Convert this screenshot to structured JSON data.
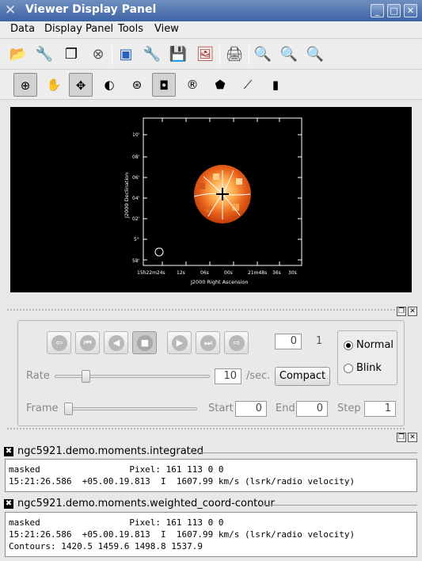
{
  "window": {
    "title": "Viewer Display Panel"
  },
  "menubar": {
    "items": [
      {
        "label": "Data"
      },
      {
        "label": "Display Panel"
      },
      {
        "label": "Tools"
      },
      {
        "label": "View"
      }
    ]
  },
  "toolbar1": {
    "icons": [
      "open-folder-icon",
      "data-manager-icon",
      "adjust-icon",
      "unload-icon",
      "new-panel-icon",
      "panel-options-icon",
      "save-icon",
      "export-image-icon",
      "print-icon",
      "zoom-fit-icon",
      "zoom-in-icon",
      "zoom-out-icon"
    ]
  },
  "toolbar2": {
    "tools": [
      "zoom-tool",
      "pan-tool",
      "crosshair-tool",
      "contrast-tool",
      "color-tool",
      "rectangle-region-tool",
      "ellipse-region-tool",
      "polygon-region-tool",
      "polyline-tool",
      "ruler-tool"
    ]
  },
  "image": {
    "colormap": "hot-orange",
    "ylabel": "J2000 Declination",
    "xlabel": "J2000 Right Ascension",
    "y_ticks": [
      "10'",
      "08'",
      "06'",
      "04'",
      "02'",
      "5°",
      "58'"
    ],
    "x_ticks": [
      "15h22m24s",
      "12s",
      "06s",
      "00s",
      "21m48s",
      "36s",
      "30s"
    ]
  },
  "animator": {
    "frame_value": "0",
    "frame_total": "1",
    "rate_label": "Rate",
    "rate_value": "10",
    "rate_unit": "/sec.",
    "compact_label": "Compact",
    "mode_normal": "Normal",
    "mode_blink": "Blink",
    "frame_label": "Frame",
    "start_label": "Start",
    "start_value": "0",
    "end_label": "End",
    "end_value": "0",
    "step_label": "Step",
    "step_value": "1"
  },
  "panels": [
    {
      "name": "ngc5921.demo.moments.integrated",
      "line1": "masked                 Pixel: 161 113 0 0",
      "line2": "15:21:26.586  +05.00.19.813  I  1607.99 km/s (lsrk/radio velocity)"
    },
    {
      "name": "ngc5921.demo.moments.weighted_coord-contour",
      "line1": "masked                 Pixel: 161 113 0 0",
      "line2": "15:21:26.586  +05.00.19.813  I  1607.99 km/s (lsrk/radio velocity)",
      "line3": "Contours: 1420.5 1459.6 1498.8 1537.9"
    }
  ]
}
